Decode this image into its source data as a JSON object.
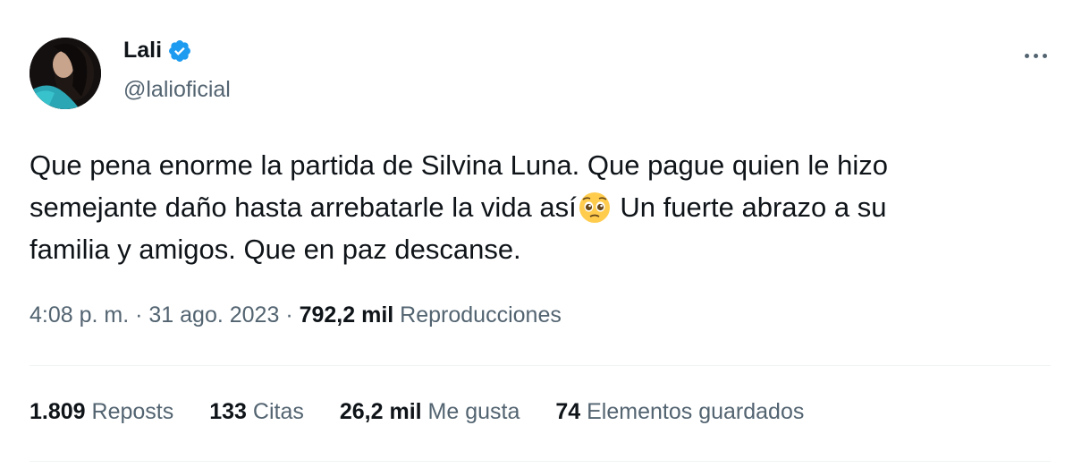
{
  "author": {
    "display_name": "Lali",
    "handle": "@lalioficial",
    "verified": true,
    "verified_color": "#1d9bf0"
  },
  "tweet": {
    "text_line1": "Que pena enorme la partida de Silvina Luna. Que pague quien le hizo",
    "text_line2a": "semejante daño hasta arrebatarle la vida así",
    "emoji": "pleading-face-emoji",
    "text_line2b": " Un fuerte abrazo a su",
    "text_line3": "familia y amigos. Que en paz descanse."
  },
  "meta": {
    "time": "4:08 p. m.",
    "sep1": " · ",
    "date": "31 ago. 2023",
    "sep2": " · ",
    "views_count": "792,2 mil",
    "views_label": " Reproducciones"
  },
  "stats": [
    {
      "count": "1.809",
      "label": " Reposts"
    },
    {
      "count": "133",
      "label": " Citas"
    },
    {
      "count": "26,2 mil",
      "label": " Me gusta"
    },
    {
      "count": "74",
      "label": " Elementos guardados"
    }
  ],
  "icons": {
    "more": "more-horizontal-icon",
    "verified": "verified-badge-icon"
  }
}
